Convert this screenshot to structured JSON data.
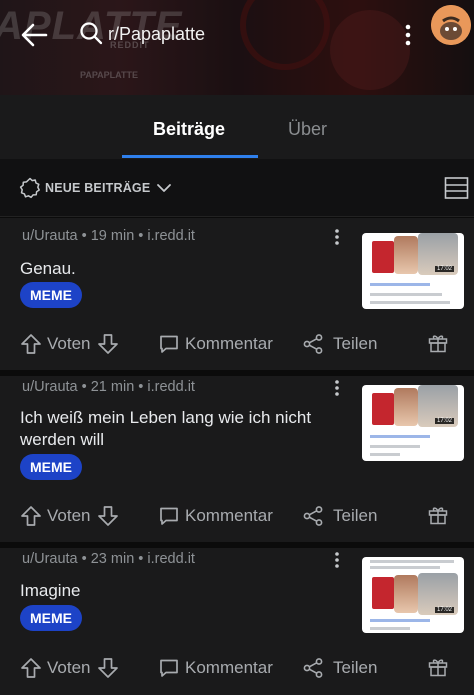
{
  "header": {
    "subreddit": "r/Papaplatte",
    "banner_watermark": "APLATTE",
    "banner_sub1": "REDDIT",
    "banner_sub2": "PAPAPLATTE"
  },
  "tabs": [
    {
      "label": "Beiträge",
      "active": true
    },
    {
      "label": "Über",
      "active": false
    }
  ],
  "sort": {
    "label": "NEUE BEITRÄGE"
  },
  "posts": [
    {
      "user": "u/Urauta",
      "age": "19 min",
      "domain": "i.redd.it",
      "meta": "u/Urauta • 19 min • i.redd.it",
      "title": "Genau.",
      "flair": "MEME",
      "thumb_time": "17:02"
    },
    {
      "user": "u/Urauta",
      "age": "21 min",
      "domain": "i.redd.it",
      "meta": "u/Urauta • 21 min • i.redd.it",
      "title": "Ich weiß mein Leben lang wie ich nicht werden will",
      "flair": "MEME",
      "thumb_time": "17:02"
    },
    {
      "user": "u/Urauta",
      "age": "23 min",
      "domain": "i.redd.it",
      "meta": "u/Urauta • 23 min • i.redd.it",
      "title": "Imagine",
      "flair": "MEME",
      "thumb_time": "17:02"
    }
  ],
  "actions": {
    "vote": "Voten",
    "comment": "Kommentar",
    "share": "Teilen"
  },
  "colors": {
    "accent": "#2f80ed",
    "flair_bg": "#1d43c7",
    "card_bg": "#1a1a1b",
    "page_bg": "#0b0b0b"
  },
  "icons": [
    "back-arrow-icon",
    "search-icon",
    "kebab-icon",
    "avatar",
    "sort-badge-icon",
    "chevron-down-icon",
    "view-layout-icon",
    "upvote-icon",
    "downvote-icon",
    "comment-icon",
    "share-icon",
    "gift-icon"
  ]
}
